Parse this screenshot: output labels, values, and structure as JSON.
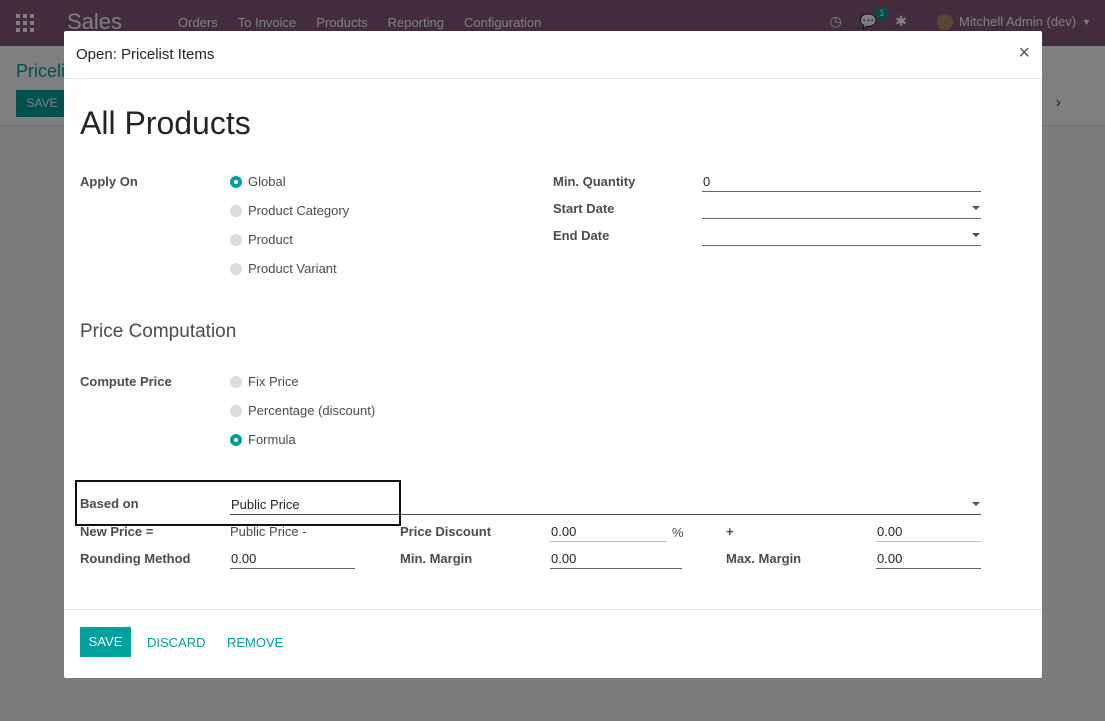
{
  "app": {
    "title": "Sales",
    "menu": [
      "Orders",
      "To Invoice",
      "Products",
      "Reporting",
      "Configuration"
    ],
    "user": "Mitchell Admin (dev)",
    "chat_badge": "1"
  },
  "control_panel": {
    "breadcrumb": "Priceli",
    "save_label": "SAVE"
  },
  "dialog": {
    "title": "Open: Pricelist Items",
    "close_glyph": "×",
    "record_name": "All Products",
    "apply_on": {
      "label": "Apply On",
      "options": [
        "Global",
        "Product Category",
        "Product",
        "Product Variant"
      ]
    },
    "min_quantity": {
      "label": "Min. Quantity",
      "value": "0"
    },
    "start_date": {
      "label": "Start Date",
      "value": ""
    },
    "end_date": {
      "label": "End Date",
      "value": ""
    },
    "price_computation": {
      "title": "Price Computation",
      "compute_label": "Compute Price",
      "options": [
        "Fix Price",
        "Percentage (discount)",
        "Formula"
      ]
    },
    "based_on": {
      "label": "Based on",
      "value": "Public Price"
    },
    "new_price": {
      "label": "New Price =",
      "value": "Public Price -"
    },
    "price_discount": {
      "label": "Price Discount",
      "value": "0.00",
      "unit": "%"
    },
    "surcharge": {
      "label": "+",
      "value": "0.00"
    },
    "rounding_method": {
      "label": "Rounding Method",
      "value": "0.00"
    },
    "min_margin": {
      "label": "Min. Margin",
      "value": "0.00"
    },
    "max_margin": {
      "label": "Max. Margin",
      "value": "0.00"
    },
    "footer": {
      "save": "SAVE",
      "discard": "DISCARD",
      "remove": "REMOVE"
    }
  }
}
